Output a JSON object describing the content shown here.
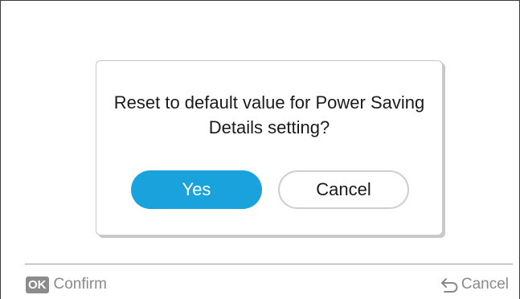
{
  "dialog": {
    "message": "Reset to default value for Power Saving Details setting?",
    "yes_label": "Yes",
    "cancel_label": "Cancel"
  },
  "footer": {
    "ok_badge": "OK",
    "confirm_label": "Confirm",
    "back_icon": "return-arrow-icon",
    "cancel_label": "Cancel"
  },
  "colors": {
    "accent": "#19a2dc",
    "footer_text": "#8a8a8a"
  }
}
